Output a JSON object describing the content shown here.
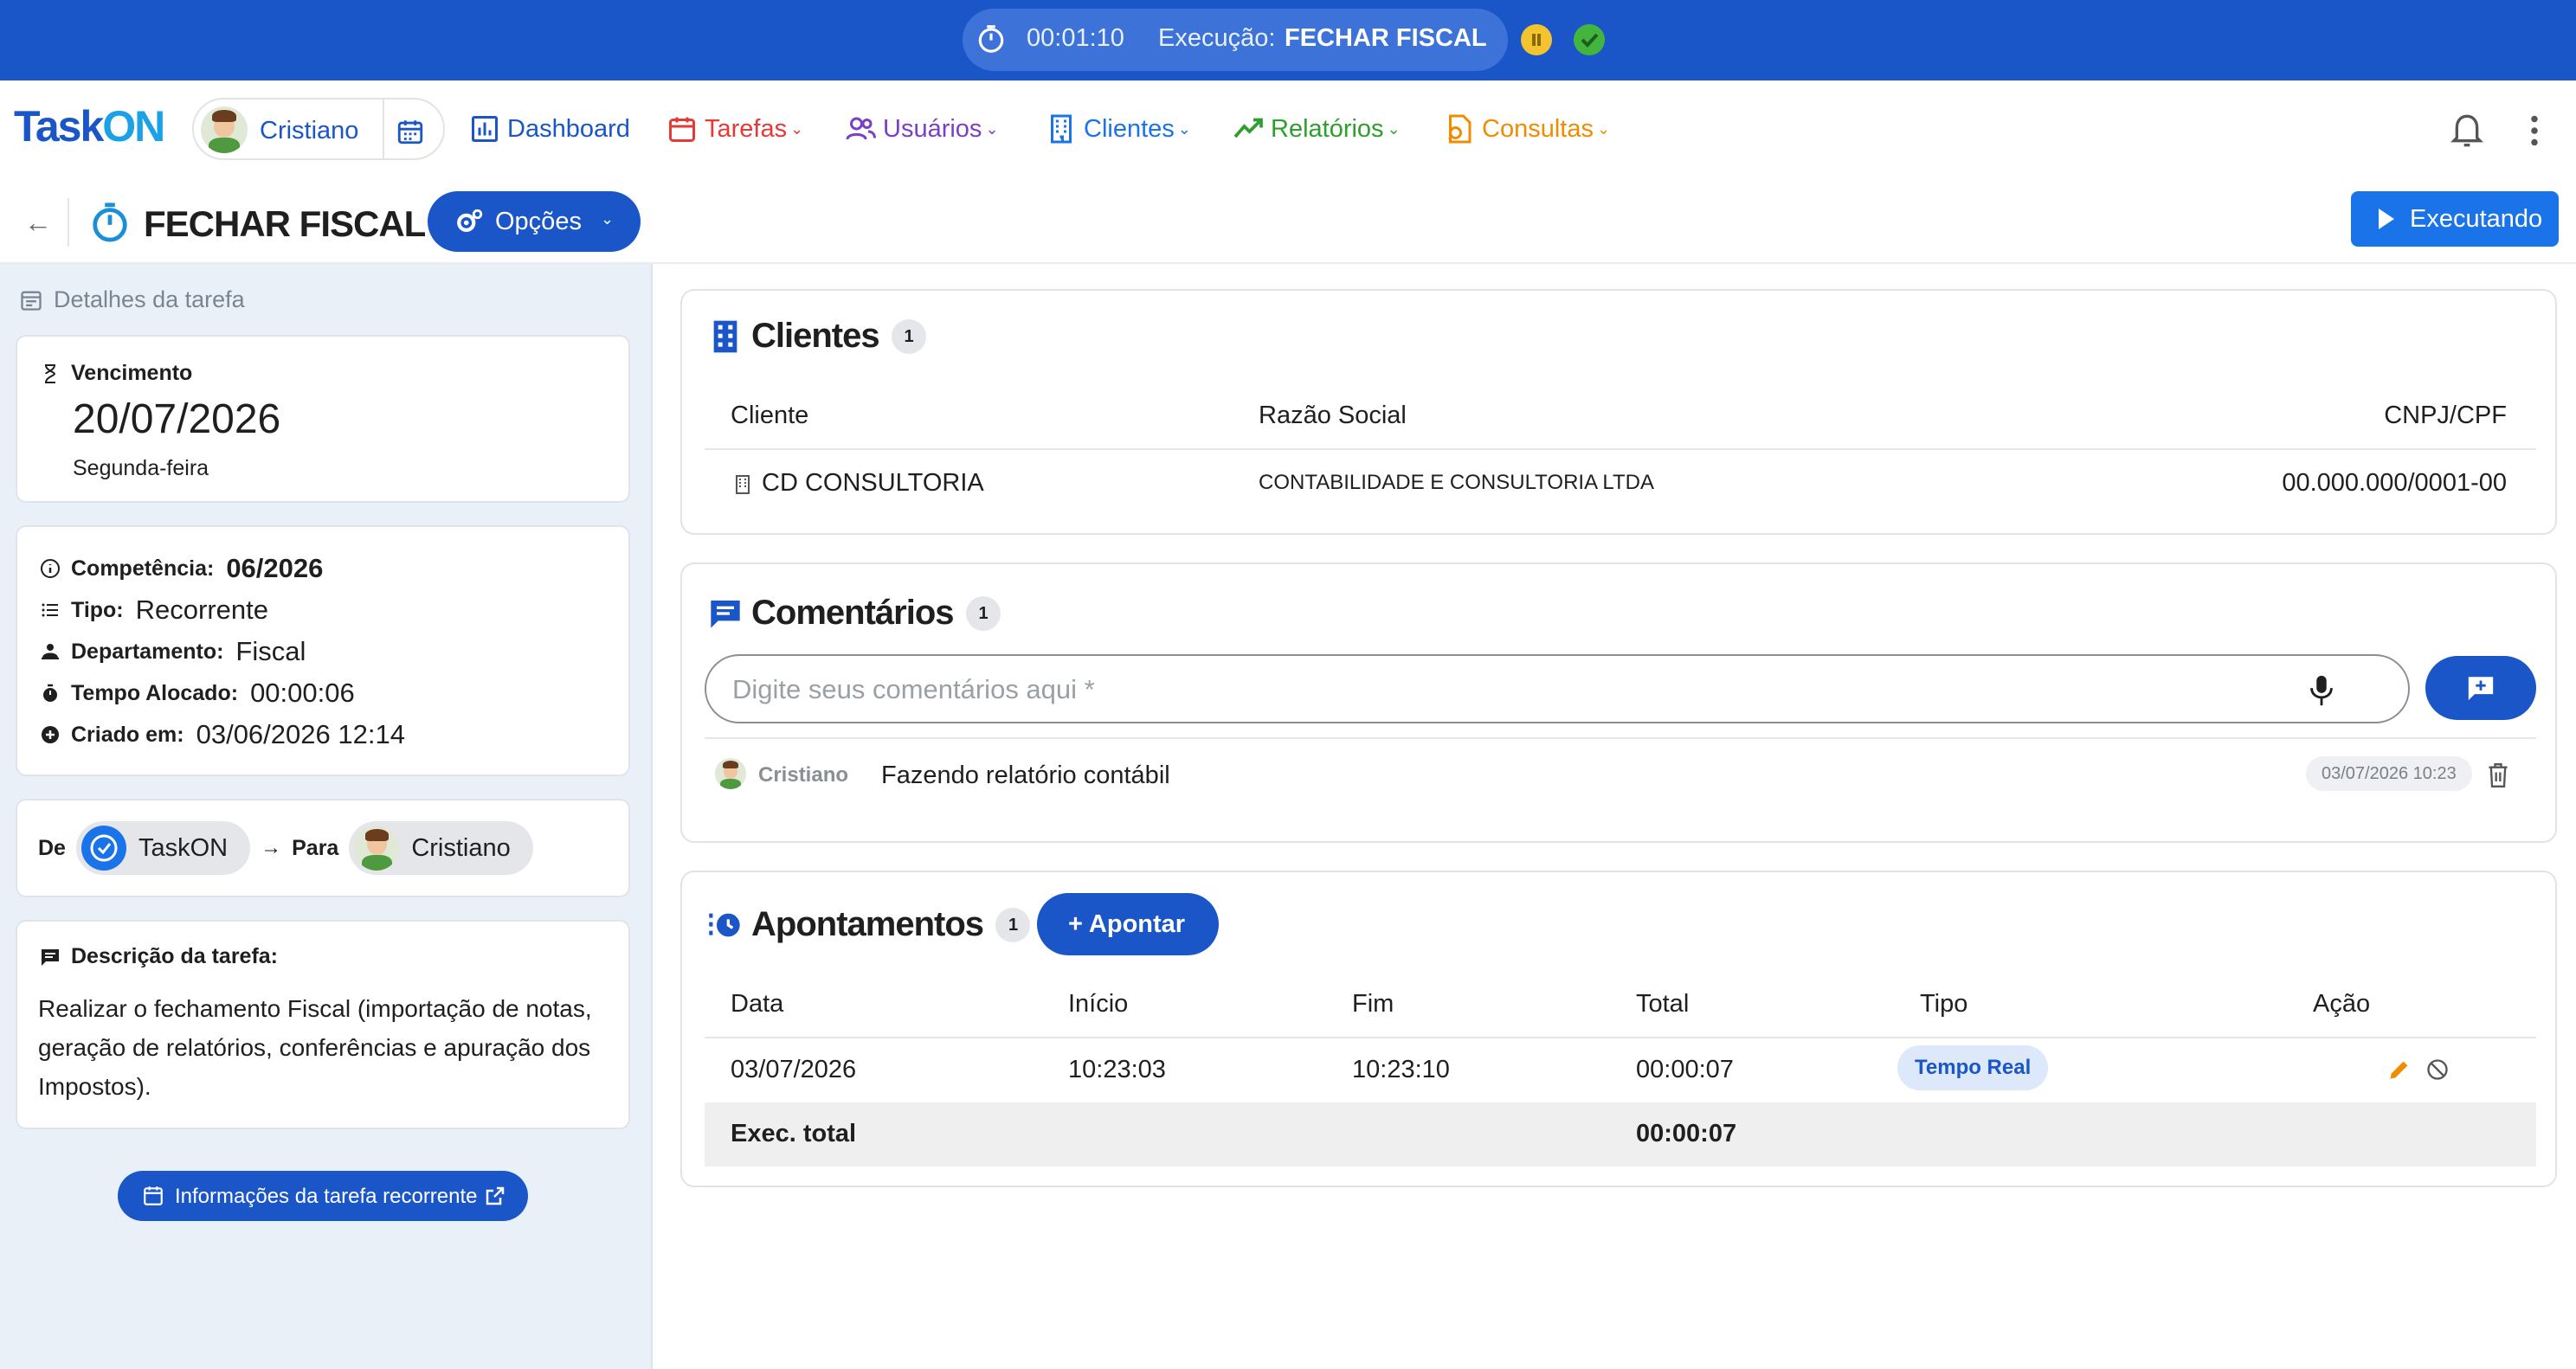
{
  "exec_bar": {
    "timer": "00:01:10",
    "label": "Execução:",
    "task": "FECHAR FISCAL",
    "icons": [
      "stopwatch-icon",
      "pause-icon",
      "check-icon"
    ],
    "colors": {
      "bar": "#1a56c7",
      "pause": "#f4c430",
      "done": "#43b53f"
    }
  },
  "nav": {
    "logo_main": "Task",
    "logo_accent": "ON",
    "user_name": "Cristiano",
    "items": [
      {
        "label": "Dashboard",
        "icon": "chart-bar-icon",
        "color": "#1a56c7",
        "has_menu": false
      },
      {
        "label": "Tarefas",
        "icon": "calendar-icon",
        "color": "#e53935",
        "has_menu": true
      },
      {
        "label": "Usuários",
        "icon": "users-icon",
        "color": "#7b3fc6",
        "has_menu": true
      },
      {
        "label": "Clientes",
        "icon": "building-icon",
        "color": "#1a73e8",
        "has_menu": true
      },
      {
        "label": "Relatórios",
        "icon": "trending-up-icon",
        "color": "#2e9e2e",
        "has_menu": true
      },
      {
        "label": "Consultas",
        "icon": "search-document-icon",
        "color": "#f08c00",
        "has_menu": true
      }
    ]
  },
  "header": {
    "title": "FECHAR FISCAL",
    "options_label": "Opções",
    "status_button": "Executando"
  },
  "sidebar": {
    "title": "Detalhes da tarefa",
    "due": {
      "label": "Vencimento",
      "date": "20/07/2026",
      "weekday": "Segunda-feira"
    },
    "info": {
      "competencia_label": "Competência:",
      "competencia": "06/2026",
      "tipo_label": "Tipo:",
      "tipo": "Recorrente",
      "departamento_label": "Departamento:",
      "departamento": "Fiscal",
      "tempo_label": "Tempo Alocado:",
      "tempo": "00:00:06",
      "criado_label": "Criado em:",
      "criado": "03/06/2026 12:14"
    },
    "transfer": {
      "from_label": "De",
      "from": "TaskON",
      "to_label": "Para",
      "to": "Cristiano"
    },
    "description": {
      "label": "Descrição da tarefa:",
      "text": "Realizar o fechamento Fiscal (importação de notas, geração de relatórios, conferências e apuração dos Impostos)."
    },
    "recurring_button": "Informações da tarefa recorrente"
  },
  "clientes": {
    "title": "Clientes",
    "count": "1",
    "headers": [
      "Cliente",
      "Razão Social",
      "CNPJ/CPF"
    ],
    "rows": [
      {
        "cliente": "CD CONSULTORIA",
        "razao": "CONTABILIDADE E CONSULTORIA LTDA",
        "cnpj": "00.000.000/0001-00"
      }
    ]
  },
  "comentarios": {
    "title": "Comentários",
    "count": "1",
    "placeholder": "Digite seus comentários aqui *",
    "items": [
      {
        "author": "Cristiano",
        "text": "Fazendo relatório contábil",
        "date": "03/07/2026 10:23"
      }
    ]
  },
  "apontamentos": {
    "title": "Apontamentos",
    "count": "1",
    "add_label": "+ Apontar",
    "headers": [
      "Data",
      "Início",
      "Fim",
      "Total",
      "Tipo",
      "Ação"
    ],
    "rows": [
      {
        "data": "03/07/2026",
        "inicio": "10:23:03",
        "fim": "10:23:10",
        "total": "00:00:07",
        "tipo": "Tempo Real"
      }
    ],
    "total_label": "Exec. total",
    "total_value": "00:00:07"
  }
}
